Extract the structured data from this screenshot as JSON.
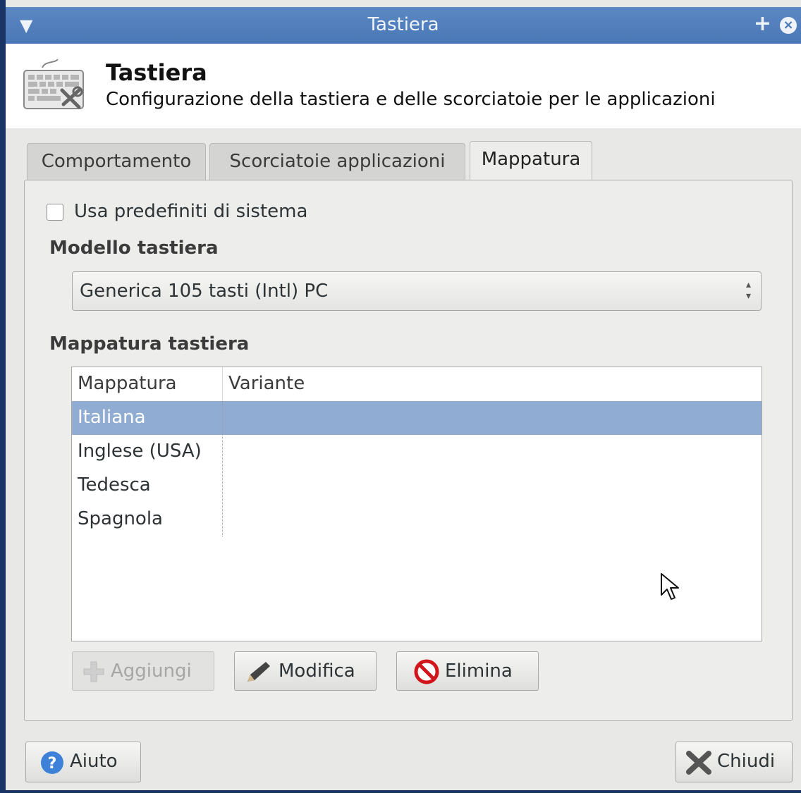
{
  "window": {
    "title": "Tastiera"
  },
  "header": {
    "title": "Tastiera",
    "subtitle": "Configurazione della tastiera e delle scorciatoie per le applicazioni",
    "icon": "keyboard-icon"
  },
  "tabs": [
    {
      "label": "Comportamento",
      "active": false
    },
    {
      "label": "Scorciatoie applicazioni",
      "active": false
    },
    {
      "label": "Mappatura",
      "active": true
    }
  ],
  "layout_tab": {
    "use_system_defaults_label": "Usa predefiniti di sistema",
    "use_system_defaults_checked": false,
    "model_section": "Modello tastiera",
    "model_value": "Generica 105 tasti (Intl) PC",
    "layout_section": "Mappatura tastiera",
    "columns": [
      "Mappatura",
      "Variante"
    ],
    "rows": [
      {
        "layout": "Italiana",
        "variant": "",
        "selected": true
      },
      {
        "layout": "Inglese (USA)",
        "variant": "",
        "selected": false
      },
      {
        "layout": "Tedesca",
        "variant": "",
        "selected": false
      },
      {
        "layout": "Spagnola",
        "variant": "",
        "selected": false
      }
    ],
    "buttons": {
      "add": "Aggiungi",
      "edit": "Modifica",
      "delete": "Elimina"
    }
  },
  "footer": {
    "help": "Aiuto",
    "close": "Chiudi"
  },
  "colors": {
    "titlebar": "#4a78b6",
    "selection": "#91acd2"
  }
}
